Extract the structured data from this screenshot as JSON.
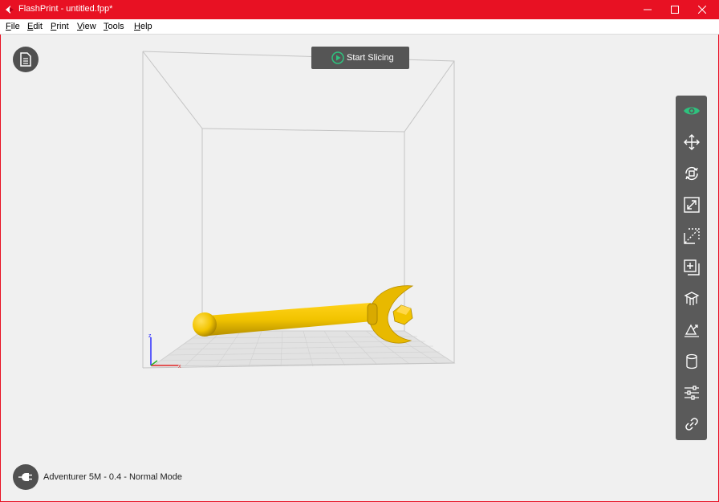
{
  "window": {
    "title": "FlashPrint - untitled.fpp*",
    "controls": [
      "minimize-icon",
      "maximize-icon",
      "close-icon"
    ]
  },
  "menu": [
    {
      "key": "F",
      "rest": "ile"
    },
    {
      "key": "E",
      "rest": "dit"
    },
    {
      "key": "P",
      "rest": "rint"
    },
    {
      "key": "V",
      "rest": "iew"
    },
    {
      "key": "T",
      "rest": "ools"
    },
    {
      "key": "H",
      "rest": "elp"
    }
  ],
  "slice_button": {
    "label": "Start Slicing",
    "icon": "play-icon"
  },
  "toolbar": {
    "tools": [
      "view-icon",
      "move-icon",
      "rotate-icon",
      "scale-icon",
      "cut-icon",
      "add-object-icon",
      "supports-icon",
      "lay-flat-icon",
      "cylinder-icon",
      "settings-sliders-icon",
      "link-icon"
    ],
    "active_color": "#2ec27e"
  },
  "axes": {
    "z": "z",
    "x": "x"
  },
  "status": {
    "printer": "Adventurer 5M - 0.4 - Normal Mode"
  },
  "colors": {
    "title_bar": "#e81123",
    "model": "#f2c400",
    "toolbar": "#5a5a5a"
  }
}
